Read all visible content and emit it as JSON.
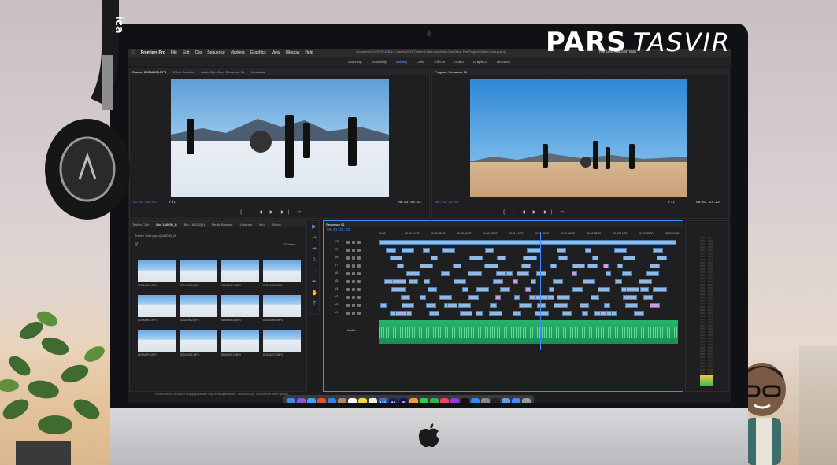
{
  "watermark": {
    "brand_bold": "PARS",
    "brand_light": "TASVIR"
  },
  "menu": {
    "app": "Premiere Pro",
    "items": [
      "File",
      "Edit",
      "Clip",
      "Sequence",
      "Markers",
      "Graphics",
      "View",
      "Window",
      "Help"
    ],
    "path": "/Volumes/G-DRIVE USB/14 Clients/2019/Tristen Cole/Look What God Gave Her/Project/Tristen Cole.prproj",
    "user": "The Lens Kid   Josh Mills"
  },
  "workspaces": {
    "items": [
      "Learning",
      "Assembly",
      "Editing",
      "Color",
      "Effects",
      "Audio",
      "Graphics",
      "Libraries"
    ],
    "active": "Editing"
  },
  "source": {
    "tabs": [
      "Source: 8D5A6985.MP4",
      "Effect Controls",
      "Audio Clip Mixer: Sequence 01",
      "Metadata"
    ],
    "tc_left": "02:43:43:01",
    "fit": "Fit",
    "tc_right": "00:02:53:53"
  },
  "program": {
    "tabs": [
      "Program: Sequence 01"
    ],
    "tc_left": "00:01:32:02",
    "fit": "Fit",
    "tc_right": "00:02:47:23"
  },
  "project": {
    "tabs": [
      "Tristen Cole",
      "Bin: 166030_B",
      "Bin: 166032(4)",
      "Media Browser",
      "Libraries",
      "Info",
      "Effects"
    ],
    "path": "Tristen Cole.prproj\\166030_B",
    "count": "31 Items",
    "items": [
      {
        "name": "8D5A6945.MP4",
        "dur": "19:10"
      },
      {
        "name": "8D5A6946.MP4",
        "dur": "23:04"
      },
      {
        "name": "8D5A6947.MP4",
        "dur": "23:08"
      },
      {
        "name": "8D5A6948.MP4",
        "dur": "19:10"
      },
      {
        "name": "8D5A6961.MP4",
        "dur": "21:20"
      },
      {
        "name": "8D5A6962.MP4",
        "dur": "21:12"
      },
      {
        "name": "8D5A6963.MP4",
        "dur": "23:09"
      },
      {
        "name": "8D5A6964.MP4",
        "dur": "2:14:02"
      },
      {
        "name": "8D5A6970.MP4",
        "dur": "21:20"
      },
      {
        "name": "8D5A6971.MP4",
        "dur": "21:13"
      },
      {
        "name": "8D5A6972.MP4",
        "dur": "23:12"
      },
      {
        "name": "8D5A6973.MP4",
        "dur": "2:14:02"
      }
    ]
  },
  "timeline": {
    "tab": "Sequence 01",
    "tc": "00:01:32:02",
    "ruler": [
      "00:00",
      "00:00:14:23",
      "00:00:29:23",
      "00:00:44:22",
      "00:00:59:22",
      "00:01:14:22",
      "00:01:29:21",
      "00:01:44:21",
      "00:01:59:21",
      "00:02:14:20",
      "00:02:29:20",
      "00:02:44:20"
    ],
    "tracks": [
      "V10",
      "V9",
      "V8",
      "V7",
      "V6",
      "V5",
      "V4",
      "V3",
      "V2",
      "V1",
      "A1",
      "A2"
    ],
    "audio_label": "Audio 1"
  },
  "hint": "Click to select, or click in empty space and drag to marquee select. Use Shift, Opt, and Cmd for other options.",
  "dock": [
    "Finder",
    "Siri",
    "Safari",
    "Chrome",
    "Mail",
    "Contacts",
    "Calendar",
    "Notes",
    "Reminders",
    "Lrc",
    "Ae",
    "Pr",
    "Photos",
    "Messages",
    "FaceTime",
    "Music",
    "Podcasts",
    "TV",
    "App Store",
    "Prefs",
    "Terminal",
    "Preview",
    "Downloads",
    "Trash"
  ],
  "colors": {
    "accent": "#3d8bff",
    "audio": "#27b56a",
    "clip": "#8fb9e6"
  }
}
